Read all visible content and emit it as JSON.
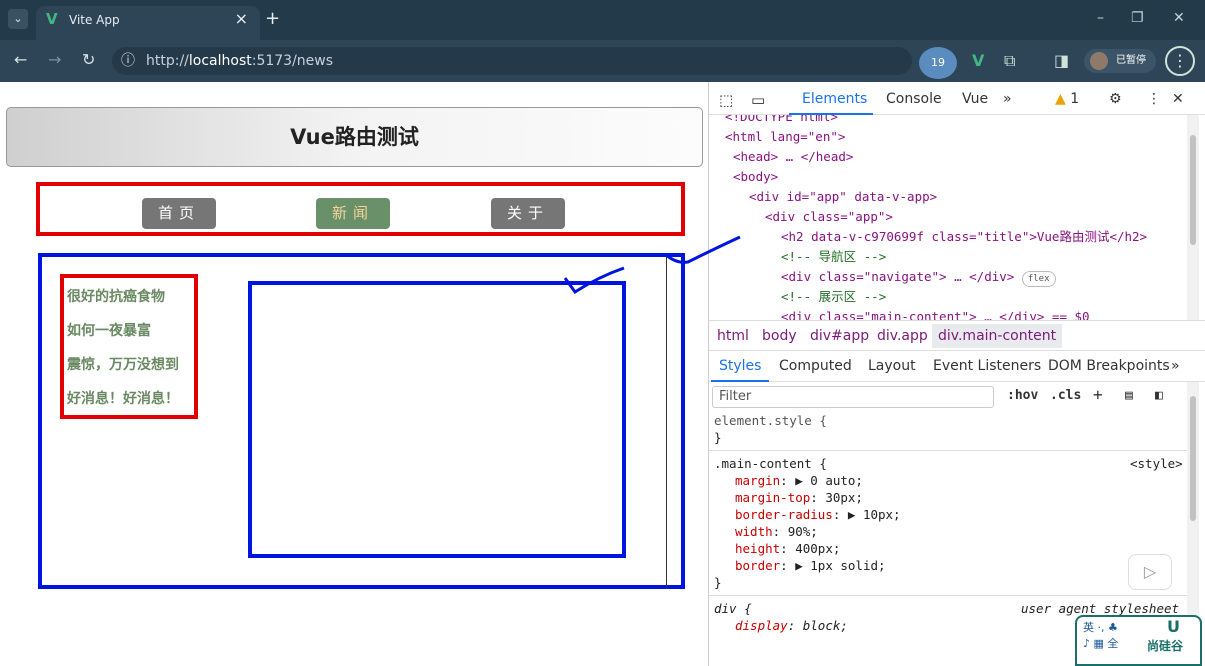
{
  "browser": {
    "tab_title": "Vite App",
    "tab_close": "×",
    "new_tab": "+",
    "url_protocol": "http://",
    "url_host": "localhost",
    "url_rest": ":5173/news",
    "avatar_badge": "19",
    "profile_label": "已暂停",
    "win_min": "–",
    "win_restore": "❐",
    "win_close": "✕"
  },
  "page": {
    "title": "Vue路由测试",
    "nav": [
      {
        "label": "首页",
        "active": false
      },
      {
        "label": "新闻",
        "active": true
      },
      {
        "label": "关于",
        "active": false
      }
    ],
    "news": [
      "很好的抗癌食物",
      "如何一夜暴富",
      "震惊，万万没想到",
      "好消息！好消息！"
    ]
  },
  "devtools": {
    "tabs": [
      "Elements",
      "Console",
      "Vue"
    ],
    "more": "»",
    "warn_count": "1",
    "code_lines": [
      {
        "indent": 16,
        "html": "<!DOCTYPE html>"
      },
      {
        "indent": 16,
        "html": "<html lang=\"en\">"
      },
      {
        "indent": 24,
        "html": "<head> … </head>"
      },
      {
        "indent": 24,
        "html": "<body>"
      },
      {
        "indent": 40,
        "html": "<div id=\"app\" data-v-app>"
      },
      {
        "indent": 56,
        "html": "<div class=\"app\">"
      },
      {
        "indent": 72,
        "html": "<h2 data-v-c970699f class=\"title\">Vue路由测试</h2>"
      },
      {
        "indent": 72,
        "html": "<!-- 导航区 -->"
      },
      {
        "indent": 72,
        "html": "<div class=\"navigate\"> … </div>"
      },
      {
        "indent": 72,
        "html": "<!-- 展示区 -->"
      },
      {
        "indent": 72,
        "html": "<div class=\"main-content\"> … </div> == $0"
      }
    ],
    "flex_badge": "flex",
    "crumbs": [
      "html",
      "body",
      "div#app",
      "div.app",
      "div.main-content"
    ],
    "style_tabs": [
      "Styles",
      "Computed",
      "Layout",
      "Event Listeners",
      "DOM Breakpoints"
    ],
    "filter_placeholder": "Filter",
    "hov": ":hov",
    "cls": ".cls",
    "element_style": "element.style {",
    "close_brace": "}",
    "rule_selector": ".main-content {",
    "rule_source": "<style>",
    "rule_props": [
      {
        "name": "margin",
        "value": "▶ 0 auto;"
      },
      {
        "name": "margin-top",
        "value": "30px;"
      },
      {
        "name": "border-radius",
        "value": "▶ 10px;"
      },
      {
        "name": "width",
        "value": "90%;"
      },
      {
        "name": "height",
        "value": "400px;"
      },
      {
        "name": "border",
        "value": "▶ 1px solid;"
      }
    ],
    "ua_selector": "div {",
    "ua_source": "user agent stylesheet",
    "ua_prop": "display",
    "ua_value": "block;"
  },
  "ime": {
    "line1": "英 ·, ♣",
    "line2": "♪ ▦ 全",
    "brand": "尚硅谷",
    "logo": "U"
  },
  "colors": {
    "nav_border": "#e10000",
    "content_border": "#0014e0",
    "active_nav": "#6a9069",
    "news_text": "#6a8a63",
    "devtools_accent": "#1a73e8"
  }
}
